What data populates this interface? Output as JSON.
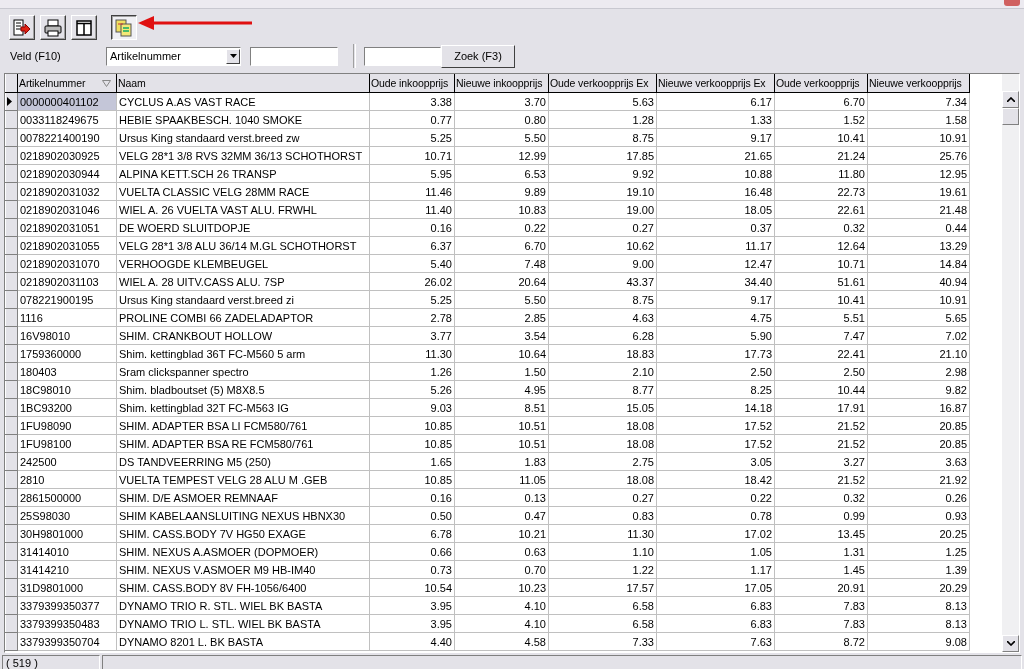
{
  "toolbar": [
    {
      "kind": "export",
      "pressed": false
    },
    {
      "kind": "print",
      "pressed": false
    },
    {
      "kind": "columns",
      "pressed": false
    },
    {
      "kind": "convert",
      "pressed": true
    }
  ],
  "filter": {
    "label": "Veld (F10)",
    "field_value": "Artikelnummer",
    "search_button": "Zoek (F3)"
  },
  "table": {
    "columns": [
      {
        "label": "Artikelnummer",
        "sorted": true
      },
      {
        "label": "Naam",
        "sorted": false
      },
      {
        "label": "Oude inkoopprijs",
        "sorted": false
      },
      {
        "label": "Nieuwe inkoopprijs",
        "sorted": false
      },
      {
        "label": "Oude verkoopprijs Ex",
        "sorted": false
      },
      {
        "label": "Nieuwe verkoopprijs Ex",
        "sorted": false
      },
      {
        "label": "Oude verkoopprijs",
        "sorted": false
      },
      {
        "label": "Nieuwe verkoopprijs",
        "sorted": false
      }
    ],
    "rows": [
      {
        "selected": true,
        "cells": [
          "0000000401102",
          "CYCLUS A.AS VAST RACE",
          "3.38",
          "3.70",
          "5.63",
          "6.17",
          "6.70",
          "7.34"
        ]
      },
      {
        "selected": false,
        "cells": [
          "0033118249675",
          "HEBIE SPAAKBESCH. 1040 SMOKE",
          "0.77",
          "0.80",
          "1.28",
          "1.33",
          "1.52",
          "1.58"
        ]
      },
      {
        "selected": false,
        "cells": [
          "0078221400190",
          "Ursus King standaard verst.breed zw",
          "5.25",
          "5.50",
          "8.75",
          "9.17",
          "10.41",
          "10.91"
        ]
      },
      {
        "selected": false,
        "cells": [
          "0218902030925",
          "VELG 28*1 3/8 RVS 32MM 36/13 SCHOTHORST",
          "10.71",
          "12.99",
          "17.85",
          "21.65",
          "21.24",
          "25.76"
        ]
      },
      {
        "selected": false,
        "cells": [
          "0218902030944",
          "ALPINA KETT.SCH 26 TRANSP",
          "5.95",
          "6.53",
          "9.92",
          "10.88",
          "11.80",
          "12.95"
        ]
      },
      {
        "selected": false,
        "cells": [
          "0218902031032",
          "VUELTA CLASSIC VELG 28MM RACE",
          "11.46",
          "9.89",
          "19.10",
          "16.48",
          "22.73",
          "19.61"
        ]
      },
      {
        "selected": false,
        "cells": [
          "0218902031046",
          "WIEL A. 26 VUELTA VAST ALU. FRWHL",
          "11.40",
          "10.83",
          "19.00",
          "18.05",
          "22.61",
          "21.48"
        ]
      },
      {
        "selected": false,
        "cells": [
          "0218902031051",
          "DE WOERD SLUITDOPJE",
          "0.16",
          "0.22",
          "0.27",
          "0.37",
          "0.32",
          "0.44"
        ]
      },
      {
        "selected": false,
        "cells": [
          "0218902031055",
          "VELG 28*1 3/8 ALU 36/14 M.GL SCHOTHORST",
          "6.37",
          "6.70",
          "10.62",
          "11.17",
          "12.64",
          "13.29"
        ]
      },
      {
        "selected": false,
        "cells": [
          "0218902031070",
          "VERHOOGDE KLEMBEUGEL",
          "5.40",
          "7.48",
          "9.00",
          "12.47",
          "10.71",
          "14.84"
        ]
      },
      {
        "selected": false,
        "cells": [
          "0218902031103",
          "WIEL A. 28  UITV.CASS ALU. 7SP",
          "26.02",
          "20.64",
          "43.37",
          "34.40",
          "51.61",
          "40.94"
        ]
      },
      {
        "selected": false,
        "cells": [
          "078221900195",
          "Ursus King standaard verst.breed zi",
          "5.25",
          "5.50",
          "8.75",
          "9.17",
          "10.41",
          "10.91"
        ]
      },
      {
        "selected": false,
        "cells": [
          "1116",
          "PROLINE COMBI 66 ZADELADAPTOR",
          "2.78",
          "2.85",
          "4.63",
          "4.75",
          "5.51",
          "5.65"
        ]
      },
      {
        "selected": false,
        "cells": [
          "16V98010",
          "SHIM. CRANKBOUT HOLLOW",
          "3.77",
          "3.54",
          "6.28",
          "5.90",
          "7.47",
          "7.02"
        ]
      },
      {
        "selected": false,
        "cells": [
          "1759360000",
          "Shim. kettingblad 36T FC-M560 5 arm",
          "11.30",
          "10.64",
          "18.83",
          "17.73",
          "22.41",
          "21.10"
        ]
      },
      {
        "selected": false,
        "cells": [
          "180403",
          "Sram clickspanner spectro",
          "1.26",
          "1.50",
          "2.10",
          "2.50",
          "2.50",
          "2.98"
        ]
      },
      {
        "selected": false,
        "cells": [
          "18C98010",
          "Shim. bladboutset (5) M8X8.5",
          "5.26",
          "4.95",
          "8.77",
          "8.25",
          "10.44",
          "9.82"
        ]
      },
      {
        "selected": false,
        "cells": [
          "1BC93200",
          "Shim. kettingblad 32T FC-M563 IG",
          "9.03",
          "8.51",
          "15.05",
          "14.18",
          "17.91",
          "16.87"
        ]
      },
      {
        "selected": false,
        "cells": [
          "1FU98090",
          "SHIM. ADAPTER BSA LI FCM580/761",
          "10.85",
          "10.51",
          "18.08",
          "17.52",
          "21.52",
          "20.85"
        ]
      },
      {
        "selected": false,
        "cells": [
          "1FU98100",
          "SHIM. ADAPTER BSA RE FCM580/761",
          "10.85",
          "10.51",
          "18.08",
          "17.52",
          "21.52",
          "20.85"
        ]
      },
      {
        "selected": false,
        "cells": [
          "242500",
          "DS TANDVEERRING M5 (250)",
          "1.65",
          "1.83",
          "2.75",
          "3.05",
          "3.27",
          "3.63"
        ]
      },
      {
        "selected": false,
        "cells": [
          "2810",
          "VUELTA TEMPEST VELG 28 ALU M .GEB",
          "10.85",
          "11.05",
          "18.08",
          "18.42",
          "21.52",
          "21.92"
        ]
      },
      {
        "selected": false,
        "cells": [
          "2861500000",
          "SHIM. D/E ASMOER REMNAAF",
          "0.16",
          "0.13",
          "0.27",
          "0.22",
          "0.32",
          "0.26"
        ]
      },
      {
        "selected": false,
        "cells": [
          "25S98030",
          "SHIM KABELAANSLUITING NEXUS HBNX30",
          "0.50",
          "0.47",
          "0.83",
          "0.78",
          "0.99",
          "0.93"
        ]
      },
      {
        "selected": false,
        "cells": [
          "30H9801000",
          "SHIM. CASS.BODY 7V HG50 EXAGE",
          "6.78",
          "10.21",
          "11.30",
          "17.02",
          "13.45",
          "20.25"
        ]
      },
      {
        "selected": false,
        "cells": [
          "31414010",
          "SHIM. NEXUS A.ASMOER (DOPMOER)",
          "0.66",
          "0.63",
          "1.10",
          "1.05",
          "1.31",
          "1.25"
        ]
      },
      {
        "selected": false,
        "cells": [
          "31414210",
          "SHIM. NEXUS V.ASMOER M9 HB-IM40",
          "0.73",
          "0.70",
          "1.22",
          "1.17",
          "1.45",
          "1.39"
        ]
      },
      {
        "selected": false,
        "cells": [
          "31D9801000",
          "SHIM. CASS.BODY 8V FH-1056/6400",
          "10.54",
          "10.23",
          "17.57",
          "17.05",
          "20.91",
          "20.29"
        ]
      },
      {
        "selected": false,
        "cells": [
          "3379399350377",
          "DYNAMO TRIO R. STL. WIEL BK BASTA",
          "3.95",
          "4.10",
          "6.58",
          "6.83",
          "7.83",
          "8.13"
        ]
      },
      {
        "selected": false,
        "cells": [
          "3379399350483",
          "DYNAMO TRIO L. STL. WIEL BK BASTA",
          "3.95",
          "4.10",
          "6.58",
          "6.83",
          "7.83",
          "8.13"
        ]
      },
      {
        "selected": false,
        "cells": [
          "3379399350704",
          "DYNAMO 8201 L. BK BASTA",
          "4.40",
          "4.58",
          "7.33",
          "7.63",
          "8.72",
          "9.08"
        ]
      }
    ]
  },
  "status_bar": {
    "count": "( 519 )"
  }
}
